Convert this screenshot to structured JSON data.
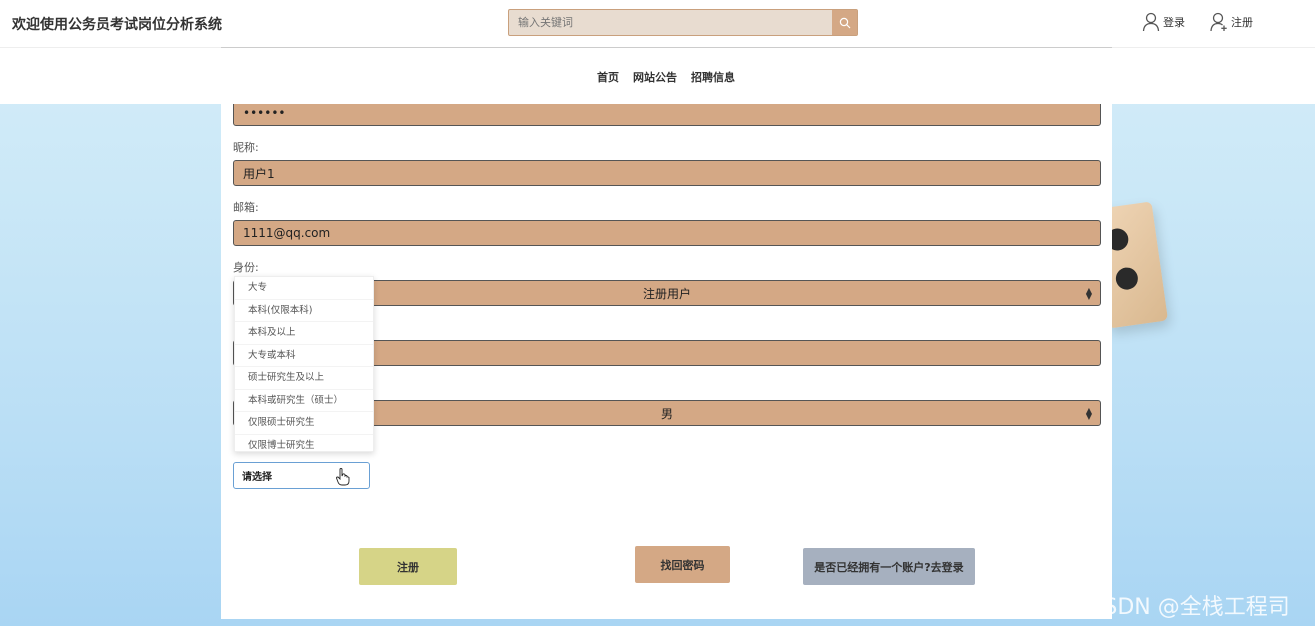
{
  "header": {
    "site_title": "欢迎使用公务员考试岗位分析系统",
    "search_placeholder": "输入关键词",
    "login_label": "登录",
    "register_label": "注册"
  },
  "nav": {
    "items": [
      "首页",
      "网站公告",
      "招聘信息"
    ]
  },
  "form": {
    "password_value": "••••••",
    "nickname_label": "昵称:",
    "nickname_value": "用户1",
    "email_label": "邮箱:",
    "email_value": "1111@qq.com",
    "role_label": "身份:",
    "role_value": "注册用户",
    "gender_value": "男",
    "education_select_value": "请选择",
    "education_options": [
      "大专",
      "本科(仅限本科)",
      "本科及以上",
      "大专或本科",
      "硕士研究生及以上",
      "本科或研究生（硕士）",
      "仅限硕士研究生",
      "仅限博士研究生"
    ]
  },
  "buttons": {
    "register": "注册",
    "recover_password": "找回密码",
    "go_login": "是否已经拥有一个账户?去登录"
  },
  "watermark": "CSDN @全栈工程司",
  "colors": {
    "field_bg": "#d4a885",
    "register_btn": "#d6d487",
    "recover_btn": "#d4a885",
    "login_btn": "#a6b0bf"
  }
}
